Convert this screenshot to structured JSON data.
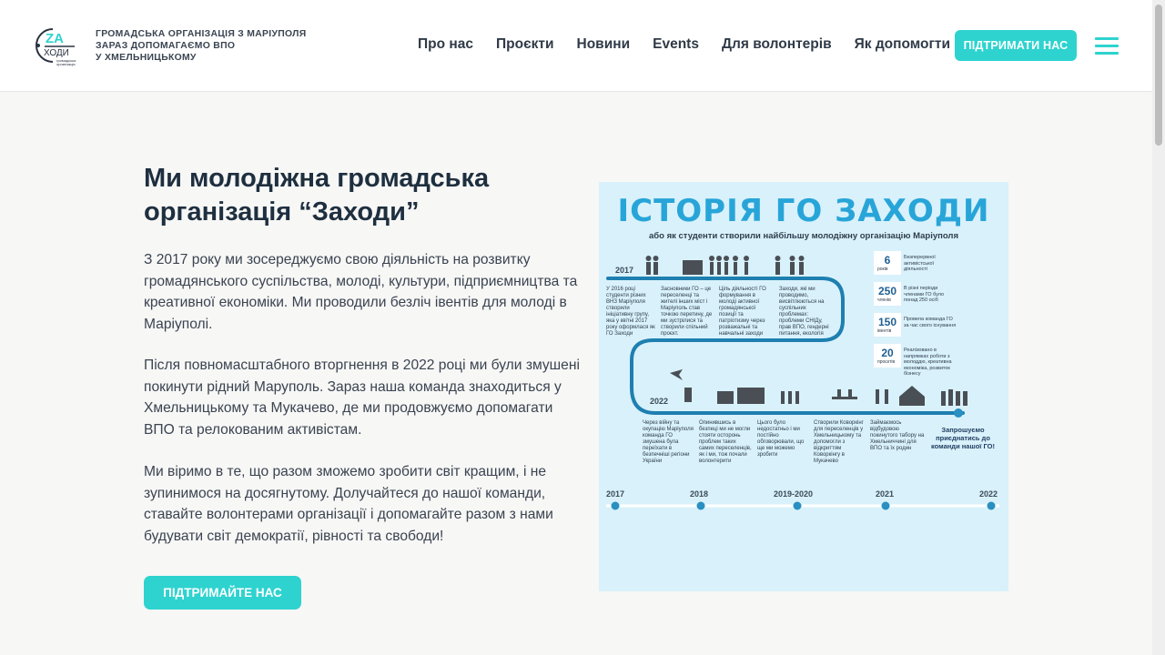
{
  "header": {
    "logo_alt": "ZAходи — громадська організація",
    "tagline_lines": [
      "ГРОМАДСЬКА ОРГАНІЗАЦІЯ З МАРІУПОЛЯ",
      "ЗАРАЗ ДОПОМАГАЄМО ВПО",
      "У ХМЕЛЬНИЦЬКОМУ"
    ],
    "nav": [
      "Про нас",
      "Проєкти",
      "Новини",
      "Events",
      "Для волонтерів",
      "Як допомогти"
    ],
    "cta": "ПІДТРИМАТИ НАС",
    "accent": "#2ed3cf"
  },
  "main": {
    "title_line1": "Ми молодіжна громадська",
    "title_line2": "організація “Заходи”",
    "paragraphs": [
      "З 2017 року ми зосереджуємо свою діяльність на розвитку громадянського суспільства, молоді, культури, підприємництва та креативної економіки. Ми проводили безліч івентів для молоді в Маріуполі.",
      "Після повномасштабного вторгнення в 2022 році ми були змушені покинути рідний Маруполь. Зараз наша команда знаходиться у Хмельницькому та Мукачево, де ми продовжуємо допомагати ВПО та релокованим активістам.",
      "Ми віримо в те, що разом зможемо зробити світ кращим, і не зупинимося на досягнутому. Долучайтеся до нашої команди, ставайте волонтерами організації і допомагайте разом з нами будувати світ демократії, рівності та свободи!"
    ],
    "cta": "ПІДТРИМАЙТЕ НАС"
  },
  "infographic": {
    "title": "ІСТОРІЯ ГО ЗАХОДИ",
    "subtitle": "або як студенти створили найбільшу молодіжну організацію Маріуполя",
    "year_2017": "2017",
    "year_2022": "2022",
    "stats": [
      {
        "num": "6",
        "unit": "років",
        "text": "Безперервної активістської діяльності"
      },
      {
        "num": "250",
        "unit": "членів",
        "text": "В різні періоди членами ГО було понад 250 осіб"
      },
      {
        "num": "150",
        "unit": "івентів",
        "text": "Провела команда ГО за час свого існування"
      },
      {
        "num": "20",
        "unit": "проєктів",
        "text": "Реалізовано в напрямках роботи з молоддю, креативна економіка, розвиток бізнесу"
      }
    ],
    "quote": "Запрошуємо приєднатись до команди нашої ГО!",
    "timeline_years": [
      "2017",
      "2018",
      "2019-2020",
      "2021",
      "2022"
    ],
    "blurbs_top": [
      "У 2016 році студенти різних ВНЗ Маріуполя створили ініціативну групу, яка у квітні 2017 року оформлася як ГО Заходи",
      "Засновники ГО – це переселенці та жителі інших міст і Маріуполь став точкою перетину, де ми зустрілися та створили спільний проєкт.",
      "Ціль діяльності ГО формування в молоді активної громадянської позиції та патріотизму через розважальні та навчальні заходи",
      "Заходи, які ми проводимо, висвітлюються на суспільних проблемах: проблеми СНІДу, прав ВПО, гендерні питання, екологія"
    ],
    "blurbs_bottom": [
      "Через війну та окупацію Маріуполя команда ГО змушена була переїхати в безпечніші регіони України",
      "Опинившись в безпеці ми не могли стояти осторонь проблем таких самих переселенців, як і ми, тож почали волонтерити",
      "Цього було недостатньо і ми постійно обговорювали, що ще ми можемо зробити",
      "Створили Коворкінг для переселенців у Хмельницькому та допомогли з відкриттям Коворкінгу в Мукачево",
      "Займаємось відбудовою покинутого табору на Хмельниччині для ВПО та їх родин"
    ]
  }
}
